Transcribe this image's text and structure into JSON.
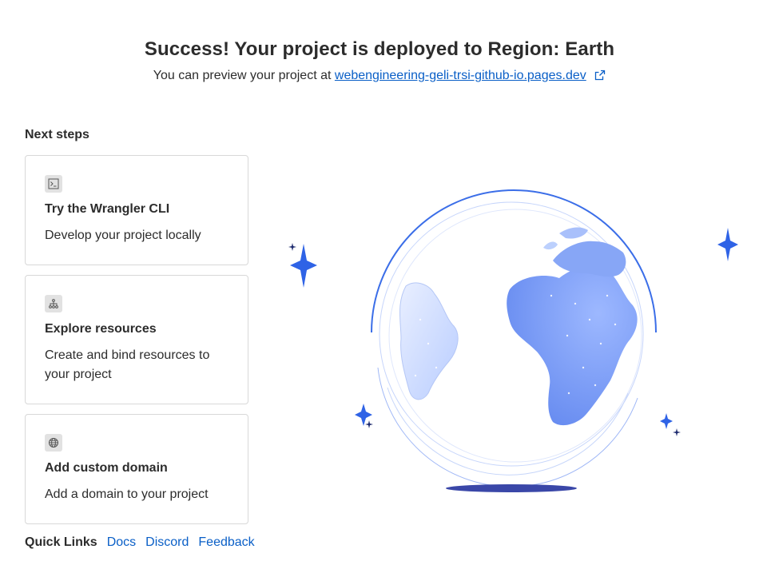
{
  "header": {
    "title": "Success! Your project is deployed to Region: Earth",
    "preview_prefix": "You can preview your project at",
    "preview_link": "webengineering-geli-trsi-github-io.pages.dev"
  },
  "next_steps": {
    "title": "Next steps",
    "cards": [
      {
        "icon": "terminal-icon",
        "title": "Try the Wrangler CLI",
        "desc": "Develop your project locally"
      },
      {
        "icon": "resources-icon",
        "title": "Explore resources",
        "desc": "Create and bind resources to your project"
      },
      {
        "icon": "globe-icon",
        "title": "Add custom domain",
        "desc": "Add a domain to your project"
      }
    ]
  },
  "quick_links": {
    "label": "Quick Links",
    "links": [
      "Docs",
      "Discord",
      "Feedback"
    ]
  },
  "colors": {
    "link": "#0a5fc7",
    "globe_blue": "#6f93f2",
    "globe_ring": "#3b6ee8",
    "sparkle": "#2f63e6",
    "shadow": "#3a47a8"
  }
}
